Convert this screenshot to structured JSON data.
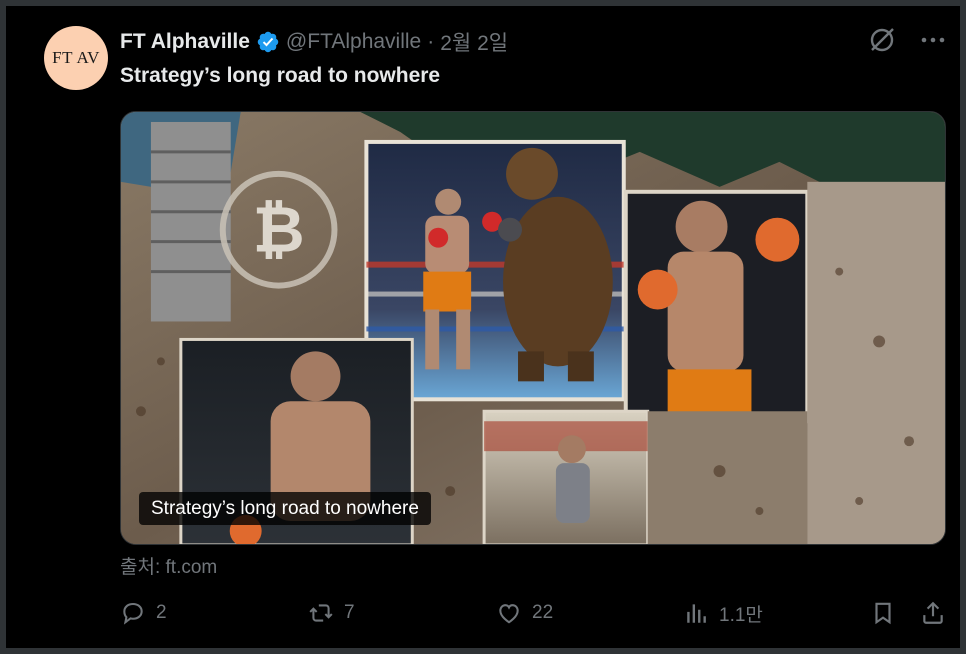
{
  "tweet": {
    "avatar_text": "FT AV",
    "display_name": "FT Alphaville",
    "handle": "@FTAlphaville",
    "separator": "·",
    "date": "2월 2일",
    "text": "Strategy’s long road to nowhere"
  },
  "card": {
    "caption": "Strategy’s long road to nowhere",
    "source": "출처: ft.com"
  },
  "top_icons": [
    "grok-icon",
    "more-icon"
  ],
  "actions": {
    "reply_count": "2",
    "retweet_count": "7",
    "like_count": "22",
    "views_count": "1.1만"
  },
  "colors": {
    "background": "#000000",
    "muted_text": "#71767b",
    "primary_text": "#e7e9ea",
    "verified_blue": "#1d9bf0",
    "avatar_bg": "#fcd0b1"
  }
}
